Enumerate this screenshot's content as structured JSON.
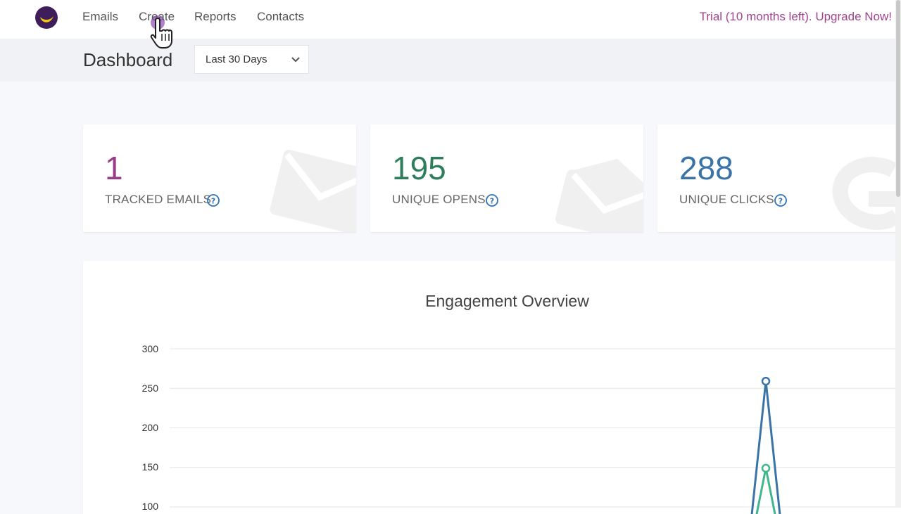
{
  "nav": {
    "logo_icon": "moon-logo-icon",
    "items": [
      {
        "label": "Emails"
      },
      {
        "label": "Create"
      },
      {
        "label": "Reports"
      },
      {
        "label": "Contacts"
      }
    ],
    "trial_text": "Trial (10 months left). Upgrade Now!"
  },
  "subheader": {
    "title": "Dashboard",
    "range": {
      "value": "Last 30 Days",
      "icon": "chevron-down-icon"
    }
  },
  "stats": [
    {
      "value": "1",
      "label": "TRACKED EMAILS",
      "color": "#9b3a8b",
      "icon": "envelope-icon"
    },
    {
      "value": "195",
      "label": "UNIQUE OPENS",
      "color": "#2e7d5b",
      "icon": "open-envelope-icon"
    },
    {
      "value": "288",
      "label": "UNIQUE CLICKS",
      "color": "#3a73a8",
      "icon": "link-icon"
    }
  ],
  "colors": {
    "accent": "#a0448e",
    "help": "#2f73b8",
    "series_clicks": "#3a73a8",
    "series_opens": "#43b58a"
  },
  "chart_data": {
    "type": "line",
    "title": "Engagement Overview",
    "ylim": [
      100,
      300
    ],
    "yticks": [
      "300",
      "250",
      "200",
      "150",
      "100"
    ],
    "grid": true,
    "series": [
      {
        "values_visible_peak": 259
      },
      {
        "values_visible_peak": 149
      }
    ]
  }
}
